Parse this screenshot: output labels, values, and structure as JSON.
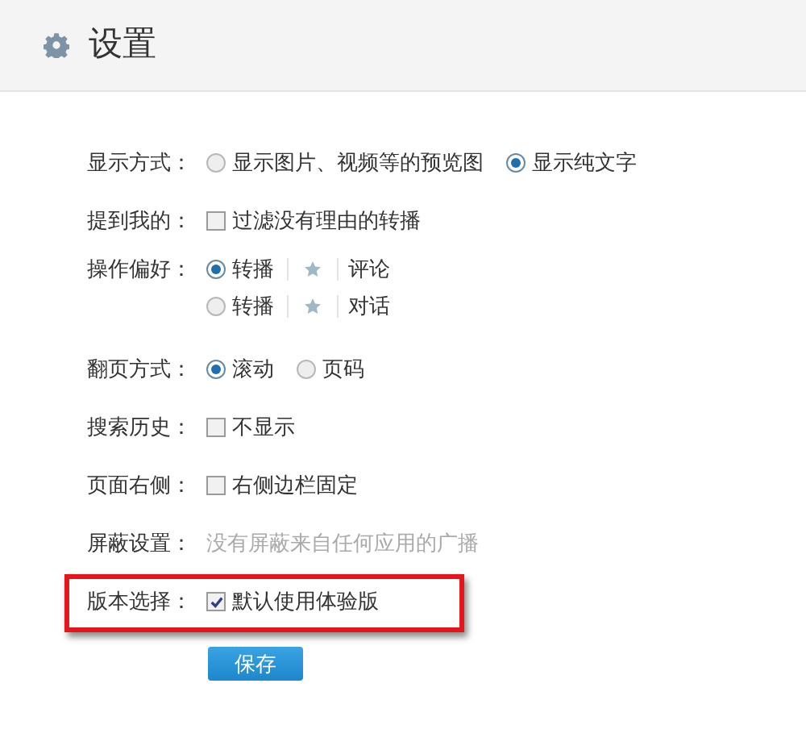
{
  "header": {
    "title": "设置"
  },
  "rows": [
    {
      "label": "显示方式：",
      "kind": "radio",
      "options": [
        {
          "text": "显示图片、视频等的预览图",
          "selected": false
        },
        {
          "text": "显示纯文字",
          "selected": true
        }
      ]
    },
    {
      "label": "提到我的：",
      "kind": "checkbox",
      "options": [
        {
          "text": "过滤没有理由的转播",
          "checked": false
        }
      ]
    },
    {
      "label": "操作偏好：",
      "kind": "action",
      "options": [
        {
          "text": "转播",
          "text_2": "评论",
          "selected": true
        },
        {
          "text": "转播",
          "text_2": "对话",
          "selected": false
        }
      ]
    },
    {
      "label": "翻页方式：",
      "kind": "radio",
      "options": [
        {
          "text": "滚动",
          "selected": true
        },
        {
          "text": "页码",
          "selected": false
        }
      ]
    },
    {
      "label": "搜索历史：",
      "kind": "checkbox",
      "options": [
        {
          "text": "不显示",
          "checked": false
        }
      ]
    },
    {
      "label": "页面右侧：",
      "kind": "checkbox",
      "options": [
        {
          "text": "右侧边栏固定",
          "checked": false
        }
      ]
    },
    {
      "label": "屏蔽设置：",
      "kind": "text",
      "value": "没有屏蔽来自任何应用的广播"
    },
    {
      "label": "版本选择：",
      "kind": "checkbox",
      "highlighted": true,
      "options": [
        {
          "text": "默认使用体验版",
          "checked": true
        }
      ]
    }
  ],
  "save_button": "保存"
}
